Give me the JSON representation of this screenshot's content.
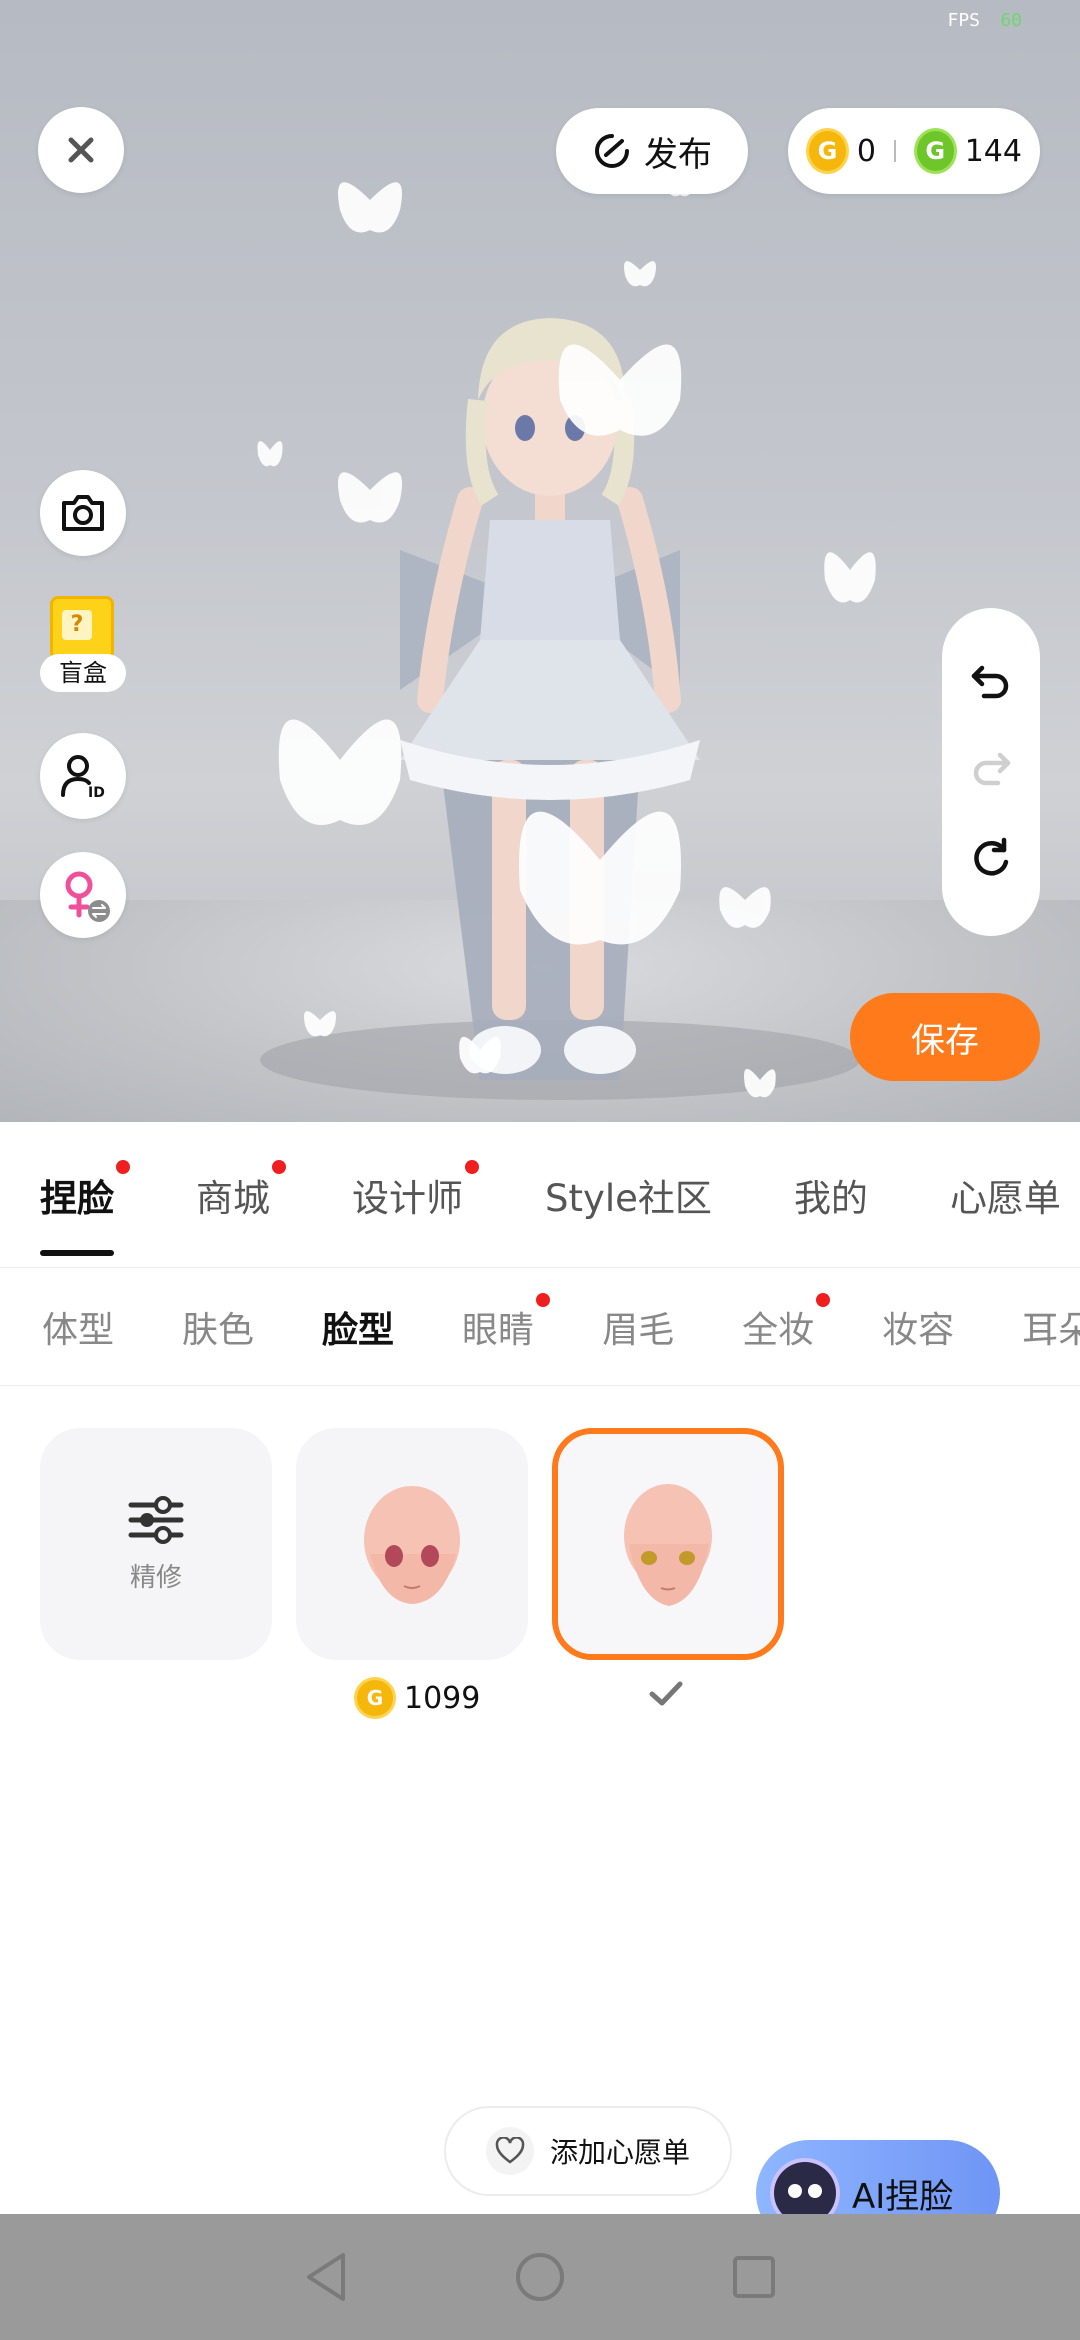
{
  "status": {
    "fps_label": "FPS",
    "fps_value": "60"
  },
  "top": {
    "publish_label": "发布",
    "gold_coins": "0",
    "green_coins": "144",
    "coin_glyph": "G"
  },
  "left_tools": {
    "blindbox_label": "盲盒",
    "blindbox_glyph": "?"
  },
  "save_label": "保存",
  "tabs": [
    {
      "label": "捏脸",
      "active": true,
      "dot": true
    },
    {
      "label": "商城",
      "active": false,
      "dot": true
    },
    {
      "label": "设计师",
      "active": false,
      "dot": true
    },
    {
      "label": "Style社区",
      "active": false,
      "dot": false
    },
    {
      "label": "我的",
      "active": false,
      "dot": false
    },
    {
      "label": "心愿单",
      "active": false,
      "dot": false
    }
  ],
  "subtabs": [
    {
      "label": "体型",
      "active": false,
      "dot": false
    },
    {
      "label": "肤色",
      "active": false,
      "dot": false
    },
    {
      "label": "脸型",
      "active": true,
      "dot": false
    },
    {
      "label": "眼睛",
      "active": false,
      "dot": true
    },
    {
      "label": "眉毛",
      "active": false,
      "dot": false
    },
    {
      "label": "全妆",
      "active": false,
      "dot": true
    },
    {
      "label": "妆容",
      "active": false,
      "dot": false
    },
    {
      "label": "耳朵",
      "active": false,
      "dot": false
    }
  ],
  "items": {
    "refine_label": "精修",
    "face1_price": "1099"
  },
  "bottom": {
    "wishlist_label": "添加心愿单",
    "ai_face_label": "AI捏脸"
  },
  "colors": {
    "accent": "#ff7a1a",
    "badge": "#f01f1f"
  }
}
